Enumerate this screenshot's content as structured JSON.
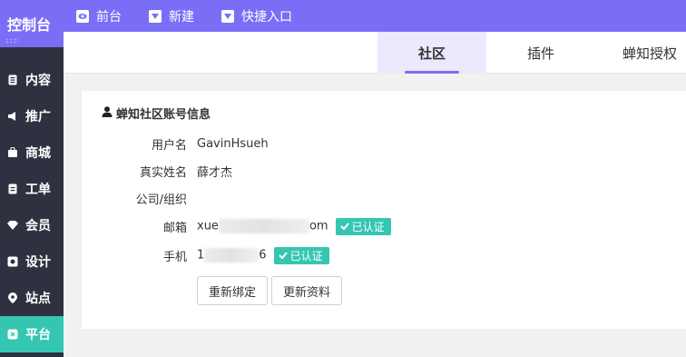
{
  "app": {
    "title": "控制台"
  },
  "sidebar": {
    "items": [
      {
        "label": "内容",
        "icon": "document-icon"
      },
      {
        "label": "推广",
        "icon": "megaphone-icon"
      },
      {
        "label": "商城",
        "icon": "shop-icon"
      },
      {
        "label": "工单",
        "icon": "ticket-icon"
      },
      {
        "label": "会员",
        "icon": "diamond-icon"
      },
      {
        "label": "设计",
        "icon": "design-icon"
      },
      {
        "label": "站点",
        "icon": "location-icon"
      },
      {
        "label": "平台",
        "icon": "platform-icon",
        "active": true
      }
    ]
  },
  "topbar": {
    "links": [
      {
        "label": "前台",
        "icon": "eye-icon"
      },
      {
        "label": "新建",
        "icon": "dropdown-icon"
      },
      {
        "label": "快捷入口",
        "icon": "dropdown-icon"
      }
    ]
  },
  "tabs": [
    {
      "label": "社区",
      "active": true
    },
    {
      "label": "插件"
    },
    {
      "label": "蝉知授权"
    }
  ],
  "panel": {
    "title": "蝉知社区账号信息",
    "fields": {
      "username_label": "用户名",
      "username": "GavinHsueh",
      "realname_label": "真实姓名",
      "realname": "薛才杰",
      "company_label": "公司/组织",
      "company": "",
      "email_label": "邮箱",
      "email_prefix": "xue",
      "email_suffix": "om",
      "phone_label": "手机",
      "phone_prefix": "1",
      "phone_suffix": "6"
    },
    "verified_badge": "已认证",
    "buttons": {
      "rebind": "重新绑定",
      "update": "更新资料"
    }
  },
  "colors": {
    "accent": "#7b6ef6",
    "sidebar_bg": "#2f3140",
    "active_green": "#35c6b2",
    "tab_active_bg": "#ebe9fb"
  }
}
